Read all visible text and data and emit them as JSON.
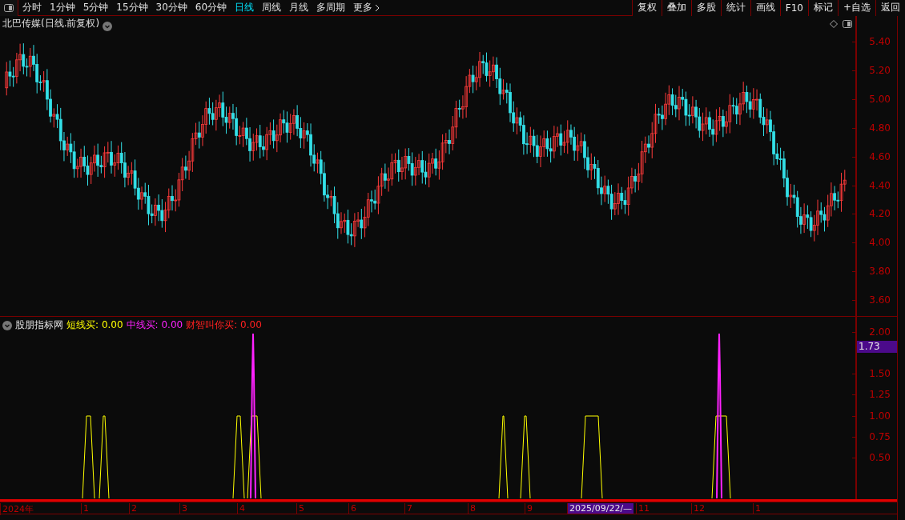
{
  "toolbar": {
    "tabs": [
      {
        "label": "分时",
        "selected": false
      },
      {
        "label": "1分钟",
        "selected": false
      },
      {
        "label": "5分钟",
        "selected": false
      },
      {
        "label": "15分钟",
        "selected": false
      },
      {
        "label": "30分钟",
        "selected": false
      },
      {
        "label": "60分钟",
        "selected": false
      },
      {
        "label": "日线",
        "selected": true
      },
      {
        "label": "周线",
        "selected": false
      },
      {
        "label": "月线",
        "selected": false
      },
      {
        "label": "多周期",
        "selected": false
      },
      {
        "label": "更多",
        "selected": false
      }
    ],
    "buttons": [
      "复权",
      "叠加",
      "多股",
      "统计",
      "画线",
      "F10",
      "标记",
      "+自选",
      "返回"
    ]
  },
  "title": "北巴传媒(日线.前复权)",
  "price_axis": {
    "ticks": [
      "5.40",
      "5.20",
      "5.00",
      "4.80",
      "4.60",
      "4.40",
      "4.20",
      "4.00",
      "3.80",
      "3.60"
    ]
  },
  "indicator": {
    "name": "股朋指标网",
    "series": [
      {
        "label": "短线买:",
        "value": "0.00",
        "color": "#ffff00"
      },
      {
        "label": "中线买:",
        "value": "0.00",
        "color": "#ff22ff"
      },
      {
        "label": "财智叫你买:",
        "value": "0.00",
        "color": "#ff2020"
      }
    ],
    "ticks": [
      "2.00",
      "1.50",
      "1.25",
      "1.00",
      "0.75",
      "0.50"
    ],
    "cursor_value": "1.73"
  },
  "date_axis": {
    "labels": [
      {
        "text": "2024年",
        "selected": false
      },
      {
        "text": "1",
        "selected": false
      },
      {
        "text": "2",
        "selected": false
      },
      {
        "text": "3",
        "selected": false
      },
      {
        "text": "4",
        "selected": false
      },
      {
        "text": "5",
        "selected": false
      },
      {
        "text": "6",
        "selected": false
      },
      {
        "text": "7",
        "selected": false
      },
      {
        "text": "8",
        "selected": false
      },
      {
        "text": "9",
        "selected": false
      },
      {
        "text": "2025/09/22/—",
        "selected": true
      },
      {
        "text": "11",
        "selected": false
      },
      {
        "text": "12",
        "selected": false
      },
      {
        "text": "1",
        "selected": false
      }
    ]
  }
}
